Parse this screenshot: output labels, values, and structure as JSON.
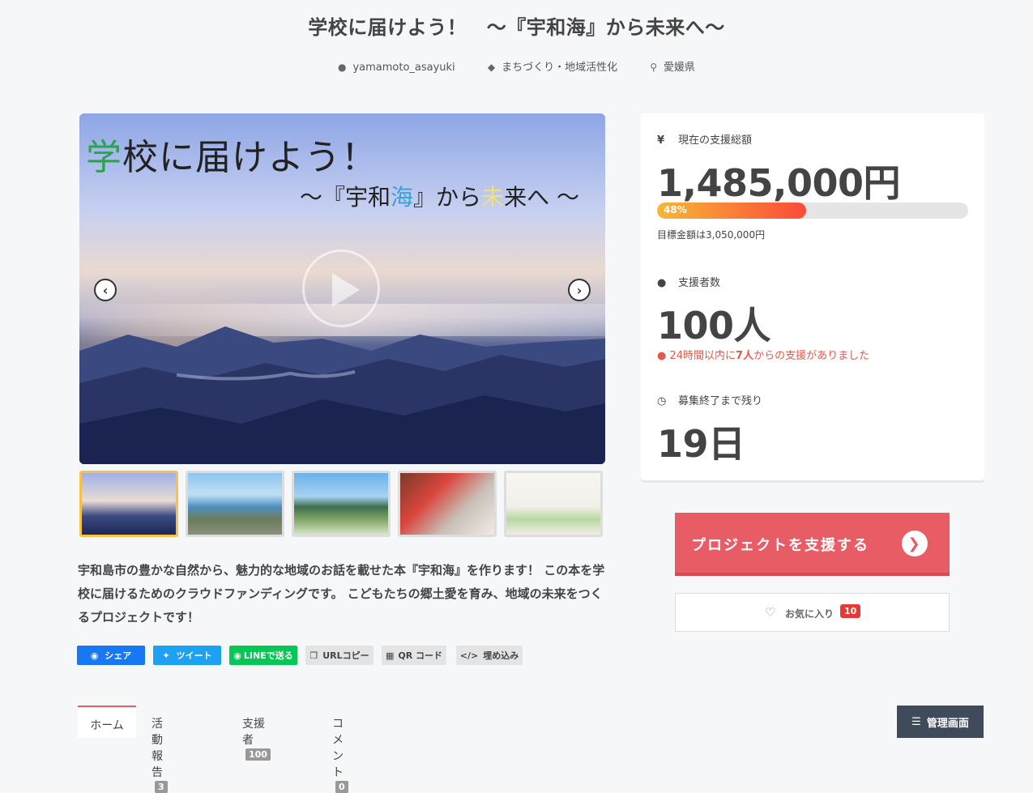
{
  "project": {
    "title": "学校に届けよう！　～『宇和海』から未来へ～",
    "author": "yamamoto_asayuki",
    "category": "まちづくり・地域活性化",
    "location": "愛媛県"
  },
  "hero": {
    "caption_line1_accent": "学",
    "caption_line1_rest": "校に届けよう！",
    "caption_line2_a": "～『宇和",
    "caption_line2_b": "海",
    "caption_line2_c": "』から",
    "caption_line2_d": "未",
    "caption_line2_e": "来へ ～",
    "prev_icon": "chevron-left-icon",
    "next_icon": "chevron-right-icon",
    "play_icon": "play-icon"
  },
  "thumbnails": [
    {
      "label": "thumb-1",
      "active": true
    },
    {
      "label": "thumb-2",
      "active": false
    },
    {
      "label": "thumb-3",
      "active": false
    },
    {
      "label": "thumb-4",
      "active": false
    },
    {
      "label": "thumb-5",
      "active": false
    }
  ],
  "description": "宇和島市の豊かな自然から、魅力的な地域のお話を載せた本『宇和海』を作ります！ この本を学校に届けるためのクラウドファンディングです。 こどもたちの郷土愛を育み、地域の未来をつくるプロジェクトです！",
  "share": {
    "facebook": "シェア",
    "twitter": "ツイート",
    "line": "LINEで送る",
    "url_copy": "URLコピー",
    "qr": "QR コード",
    "embed": "埋め込み"
  },
  "stats": {
    "funding_label": "現在の支援総額",
    "funding_amount": "1,485,000円",
    "progress_percent": 48,
    "progress_text": "48%",
    "goal_text": "目標金額は3,050,000円",
    "supporters_label": "支援者数",
    "supporters_count": "100人",
    "recent_prefix": "24時間以内に",
    "recent_count": "7人",
    "recent_suffix": "からの支援がありました",
    "remaining_label": "募集終了まで残り",
    "remaining_days": "19日"
  },
  "actions": {
    "support_label": "プロジェクトを支援する",
    "favorite_label": "お気に入り",
    "favorite_count": "10"
  },
  "tabs": [
    {
      "label": "ホーム",
      "badge": ""
    },
    {
      "label": "活動報告",
      "badge": "3"
    },
    {
      "label": "支援者",
      "badge": "100"
    },
    {
      "label": "コメント",
      "badge": "0"
    }
  ],
  "admin_label": "管理画面",
  "colors": {
    "accent": "#e85d65",
    "progress_start": "#f7b733",
    "progress_end": "#fc4a3a",
    "facebook": "#1877f2",
    "twitter": "#1da1f2",
    "line": "#06c755",
    "admin_bg": "#3f4a5a"
  }
}
